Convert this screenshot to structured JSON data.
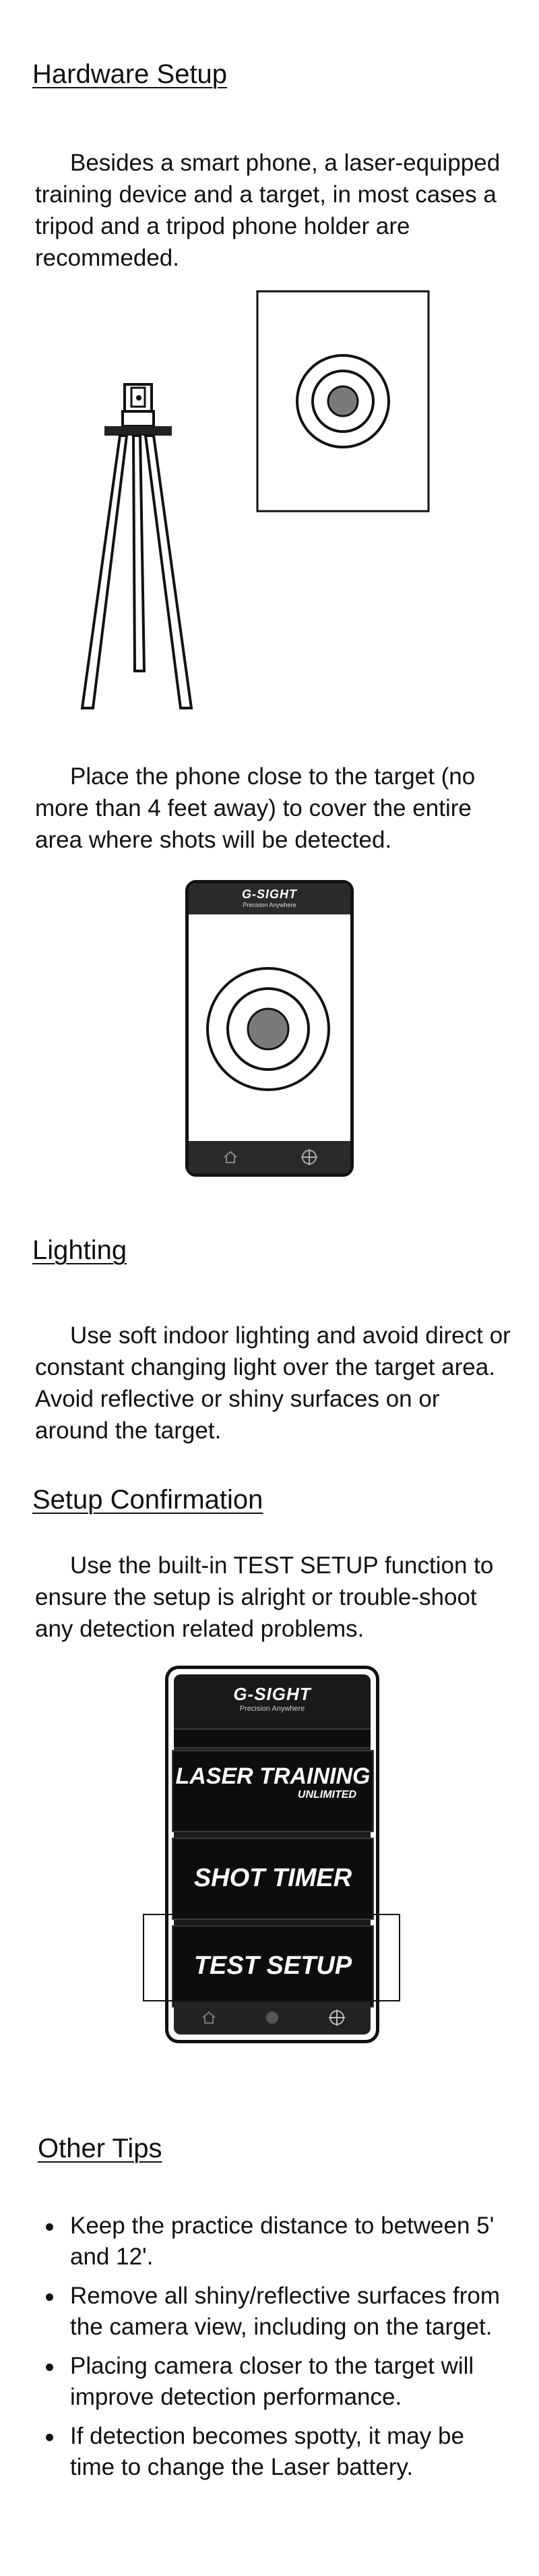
{
  "sections": {
    "hardware": {
      "title": "Hardware Setup",
      "paragraph1": "Besides a smart phone, a laser-equipped training device and a target, in most cases a tripod and a tripod phone holder are recommeded.",
      "paragraph2": "Place the phone close to the target (no more than 4 feet away) to cover the entire area where shots will be detected."
    },
    "lighting": {
      "title": "Lighting",
      "paragraph": "Use soft indoor lighting and avoid direct or constant changing light over the target area. Avoid reflective or shiny surfaces on or around the target."
    },
    "confirmation": {
      "title": "Setup Confirmation",
      "paragraph": "Use the built-in TEST SETUP function to ensure the setup is alright or trouble-shoot any detection related problems."
    },
    "tips": {
      "title": "Other Tips",
      "items": [
        "Keep the practice distance to between 5' and 12'.",
        "Remove all shiny/reflective surfaces from the camera view, including on the target.",
        "Placing camera closer to the target will improve detection performance.",
        "If detection becomes spotty, it may be time to change the Laser battery."
      ]
    }
  },
  "app_mockup": {
    "logo": "G-SIGHT",
    "tagline": "Precision Anywhere",
    "menu": {
      "laser_training": "LASER TRAINING",
      "laser_training_sub": "UNLIMITED",
      "shot_timer": "SHOT TIMER",
      "test_setup": "TEST SETUP"
    },
    "icons": [
      "home-icon",
      "crosshair-icon"
    ]
  },
  "colors": {
    "text": "#111111",
    "phone_bar": "#2a2a2a",
    "target_bullseye": "#7a7a7a",
    "app_background": "#0d0d0d"
  }
}
